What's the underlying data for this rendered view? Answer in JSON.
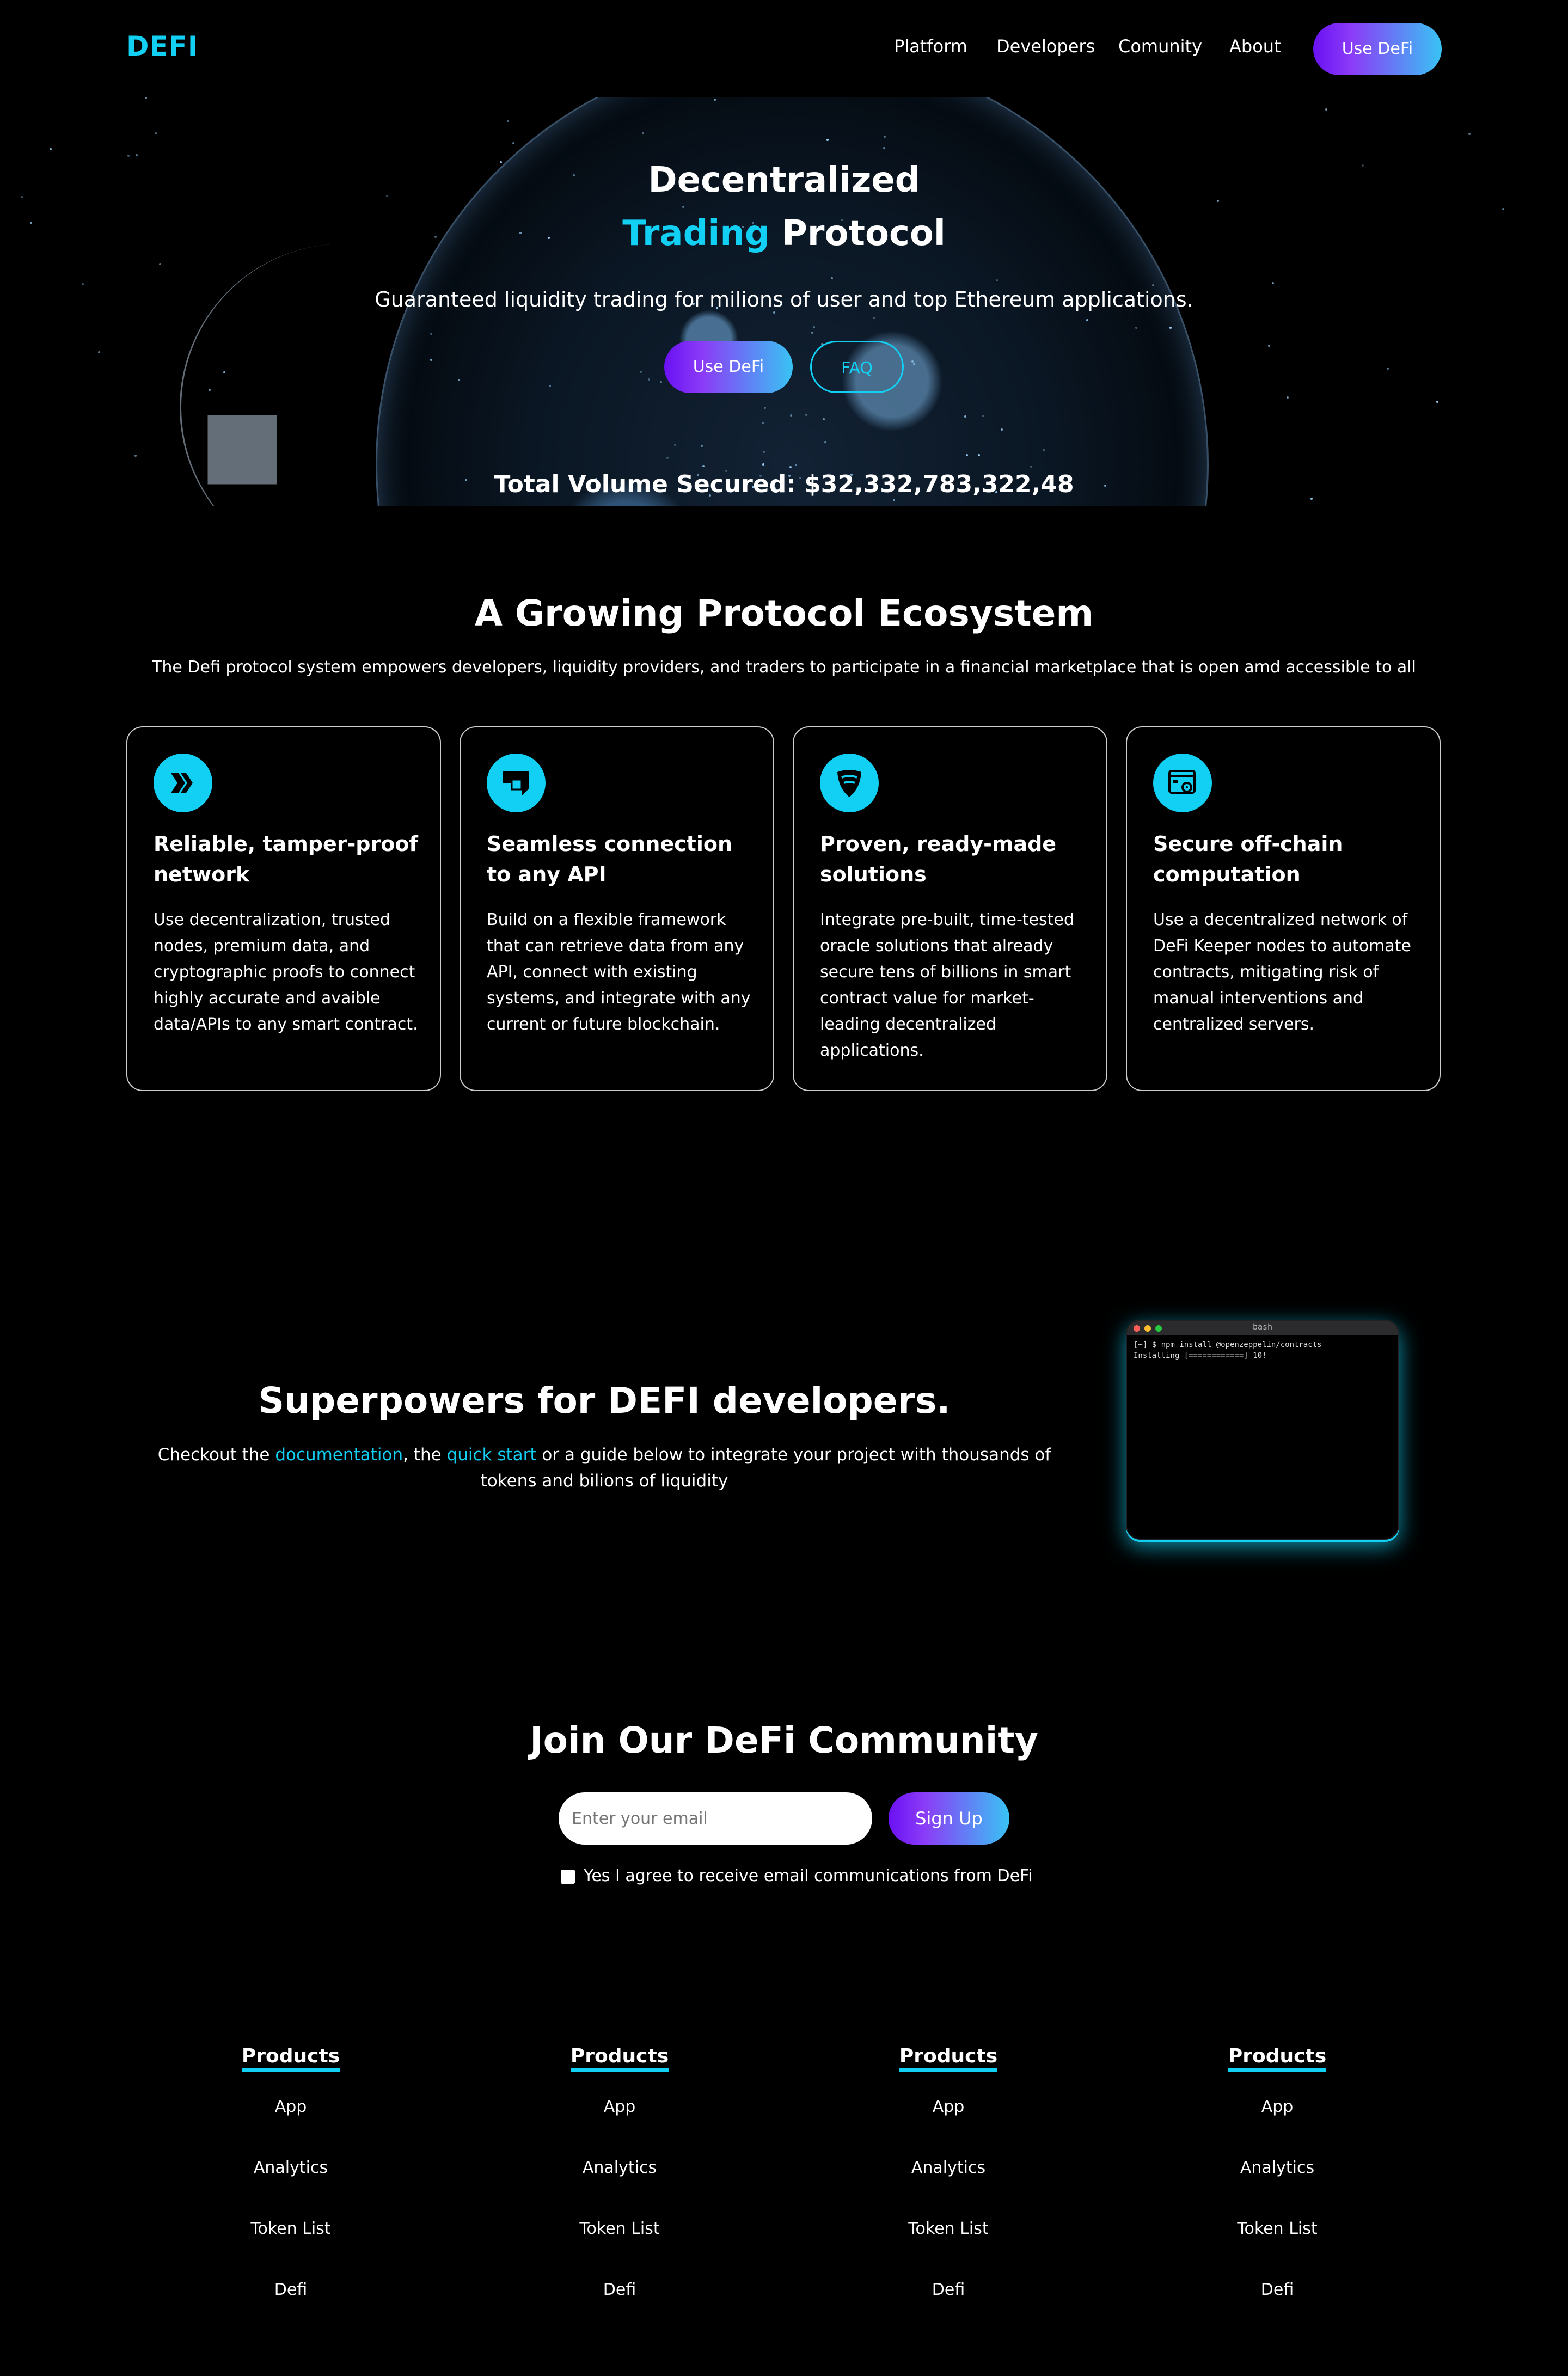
{
  "header": {
    "logo": "DEFI",
    "nav": [
      "Platform",
      "Developers",
      "Comunity",
      "About"
    ],
    "cta": "Use DeFi"
  },
  "hero": {
    "title_line1": "Decentralized",
    "title_accent": "Trading",
    "title_rest": "Protocol",
    "subtitle": "Guaranteed liquidity trading for milions of user and top Ethereum applications.",
    "primary_button": "Use DeFi",
    "secondary_button": "FAQ",
    "volume": "Total Volume Secured: $32,332,783,322,48"
  },
  "ecosystem": {
    "title": "A Growing Protocol Ecosystem",
    "subtitle": "The Defi protocol system empowers developers, liquidity providers, and traders to participate in a financial marketplace that is open amd accessible to all",
    "cards": [
      {
        "icon": "chevrons-icon",
        "title": "Reliable, tamper-proof network",
        "text": "Use decentralization, trusted nodes, premium data, and cryptographic proofs to connect highly accurate and avaible data/APIs to any smart contract."
      },
      {
        "icon": "layers-icon",
        "title": "Seamless connection to any API",
        "text": "Build on a flexible framework that can retrieve data from any API, connect with existing systems, and integrate with any current or future blockchain."
      },
      {
        "icon": "shield-icon",
        "title": "Proven, ready-made solutions",
        "text": "Integrate pre-built, time-tested oracle solutions that already secure tens of billions in smart contract value for market-leading decentralized applications."
      },
      {
        "icon": "server-gear-icon",
        "title": "Secure off-chain computation",
        "text": "Use a decentralized network of DeFi Keeper nodes to automate contracts, mitigating risk of manual interventions and centralized servers."
      }
    ]
  },
  "developers": {
    "title": "Superpowers for DEFI developers.",
    "text_before": "Checkout the ",
    "link1": "documentation",
    "text_mid": ", the ",
    "link2": "quick start",
    "text_after": " or a guide below to integrate your project with thousands of tokens and bilions of liquidity",
    "terminal": {
      "title": "bash",
      "line1": "[~] $ npm install @openzeppelin/contracts",
      "line2": "Installing [============] 10!"
    }
  },
  "community": {
    "title": "Join Our DeFi Community",
    "email_placeholder": "Enter your email",
    "signup": "Sign Up",
    "consent": "Yes I agree to receive email communications from DeFi"
  },
  "footer": {
    "columns": [
      {
        "heading": "Products",
        "links": [
          "App",
          "Analytics",
          "Token List",
          "Defi"
        ]
      },
      {
        "heading": "Products",
        "links": [
          "App",
          "Analytics",
          "Token List",
          "Defi"
        ]
      },
      {
        "heading": "Products",
        "links": [
          "App",
          "Analytics",
          "Token List",
          "Defi"
        ]
      },
      {
        "heading": "Products",
        "links": [
          "App",
          "Analytics",
          "Token List",
          "Defi"
        ]
      }
    ]
  },
  "colors": {
    "accent": "#12d0f3",
    "gradient_start": "#6a11f4",
    "gradient_end": "#39c3f4",
    "background": "#000000"
  }
}
